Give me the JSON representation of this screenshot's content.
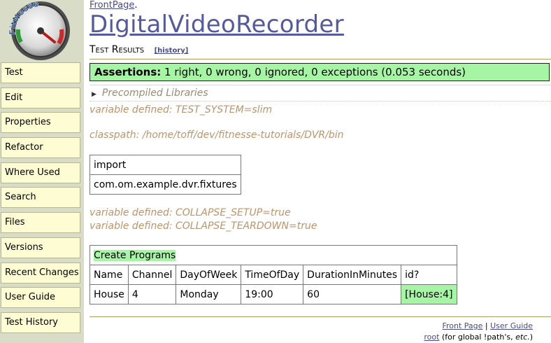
{
  "logo": {
    "text": "FitNesse"
  },
  "sidebar": {
    "items": [
      {
        "label": "Test"
      },
      {
        "label": "Edit"
      },
      {
        "label": "Properties"
      },
      {
        "label": "Refactor"
      },
      {
        "label": "Where Used"
      },
      {
        "label": "Search"
      },
      {
        "label": "Files"
      },
      {
        "label": "Versions"
      },
      {
        "label": "Recent Changes"
      },
      {
        "label": "User Guide"
      },
      {
        "label": "Test History"
      }
    ]
  },
  "header": {
    "breadcrumb": "FrontPage",
    "breadcrumb_sep": ".",
    "title": "DigitalVideoRecorder",
    "subtitle": "Test Results",
    "history_link": "[history]"
  },
  "assertions": {
    "label": "Assertions:",
    "text": " 1 right, 0 wrong, 0 ignored, 0 exceptions (0.053 seconds)"
  },
  "collapsible": {
    "label": "Precompiled Libraries"
  },
  "notes": {
    "test_system": "variable defined: TEST_SYSTEM=slim",
    "classpath": "classpath: /home/toff/dev/fitnesse-tutorials/DVR/bin",
    "collapse_setup": "variable defined: COLLAPSE_SETUP=true",
    "collapse_teardown": "variable defined: COLLAPSE_TEARDOWN=true"
  },
  "import_table": {
    "header": "import",
    "value": "com.om.example.dvr.fixtures"
  },
  "programs_table": {
    "title": "Create Programs",
    "columns": [
      "Name",
      "Channel",
      "DayOfWeek",
      "TimeOfDay",
      "DurationInMinutes",
      "id?"
    ],
    "rows": [
      [
        "House",
        "4",
        "Monday",
        "19:00",
        "60",
        "[House:4]"
      ]
    ]
  },
  "footer": {
    "front_page": "Front Page",
    "sep": " | ",
    "user_guide": "User Guide",
    "root": "root",
    "root_note_pre": " (for global !path's, ",
    "root_note_etc": "etc.",
    "root_note_post": ")"
  },
  "colors": {
    "sidebar_bg": "#d9dcc6",
    "nav_button_bg": "#fdfcd2",
    "pass_green": "#a6f5a4",
    "title_blue": "#555aa0",
    "note_brown": "#c0936a"
  }
}
